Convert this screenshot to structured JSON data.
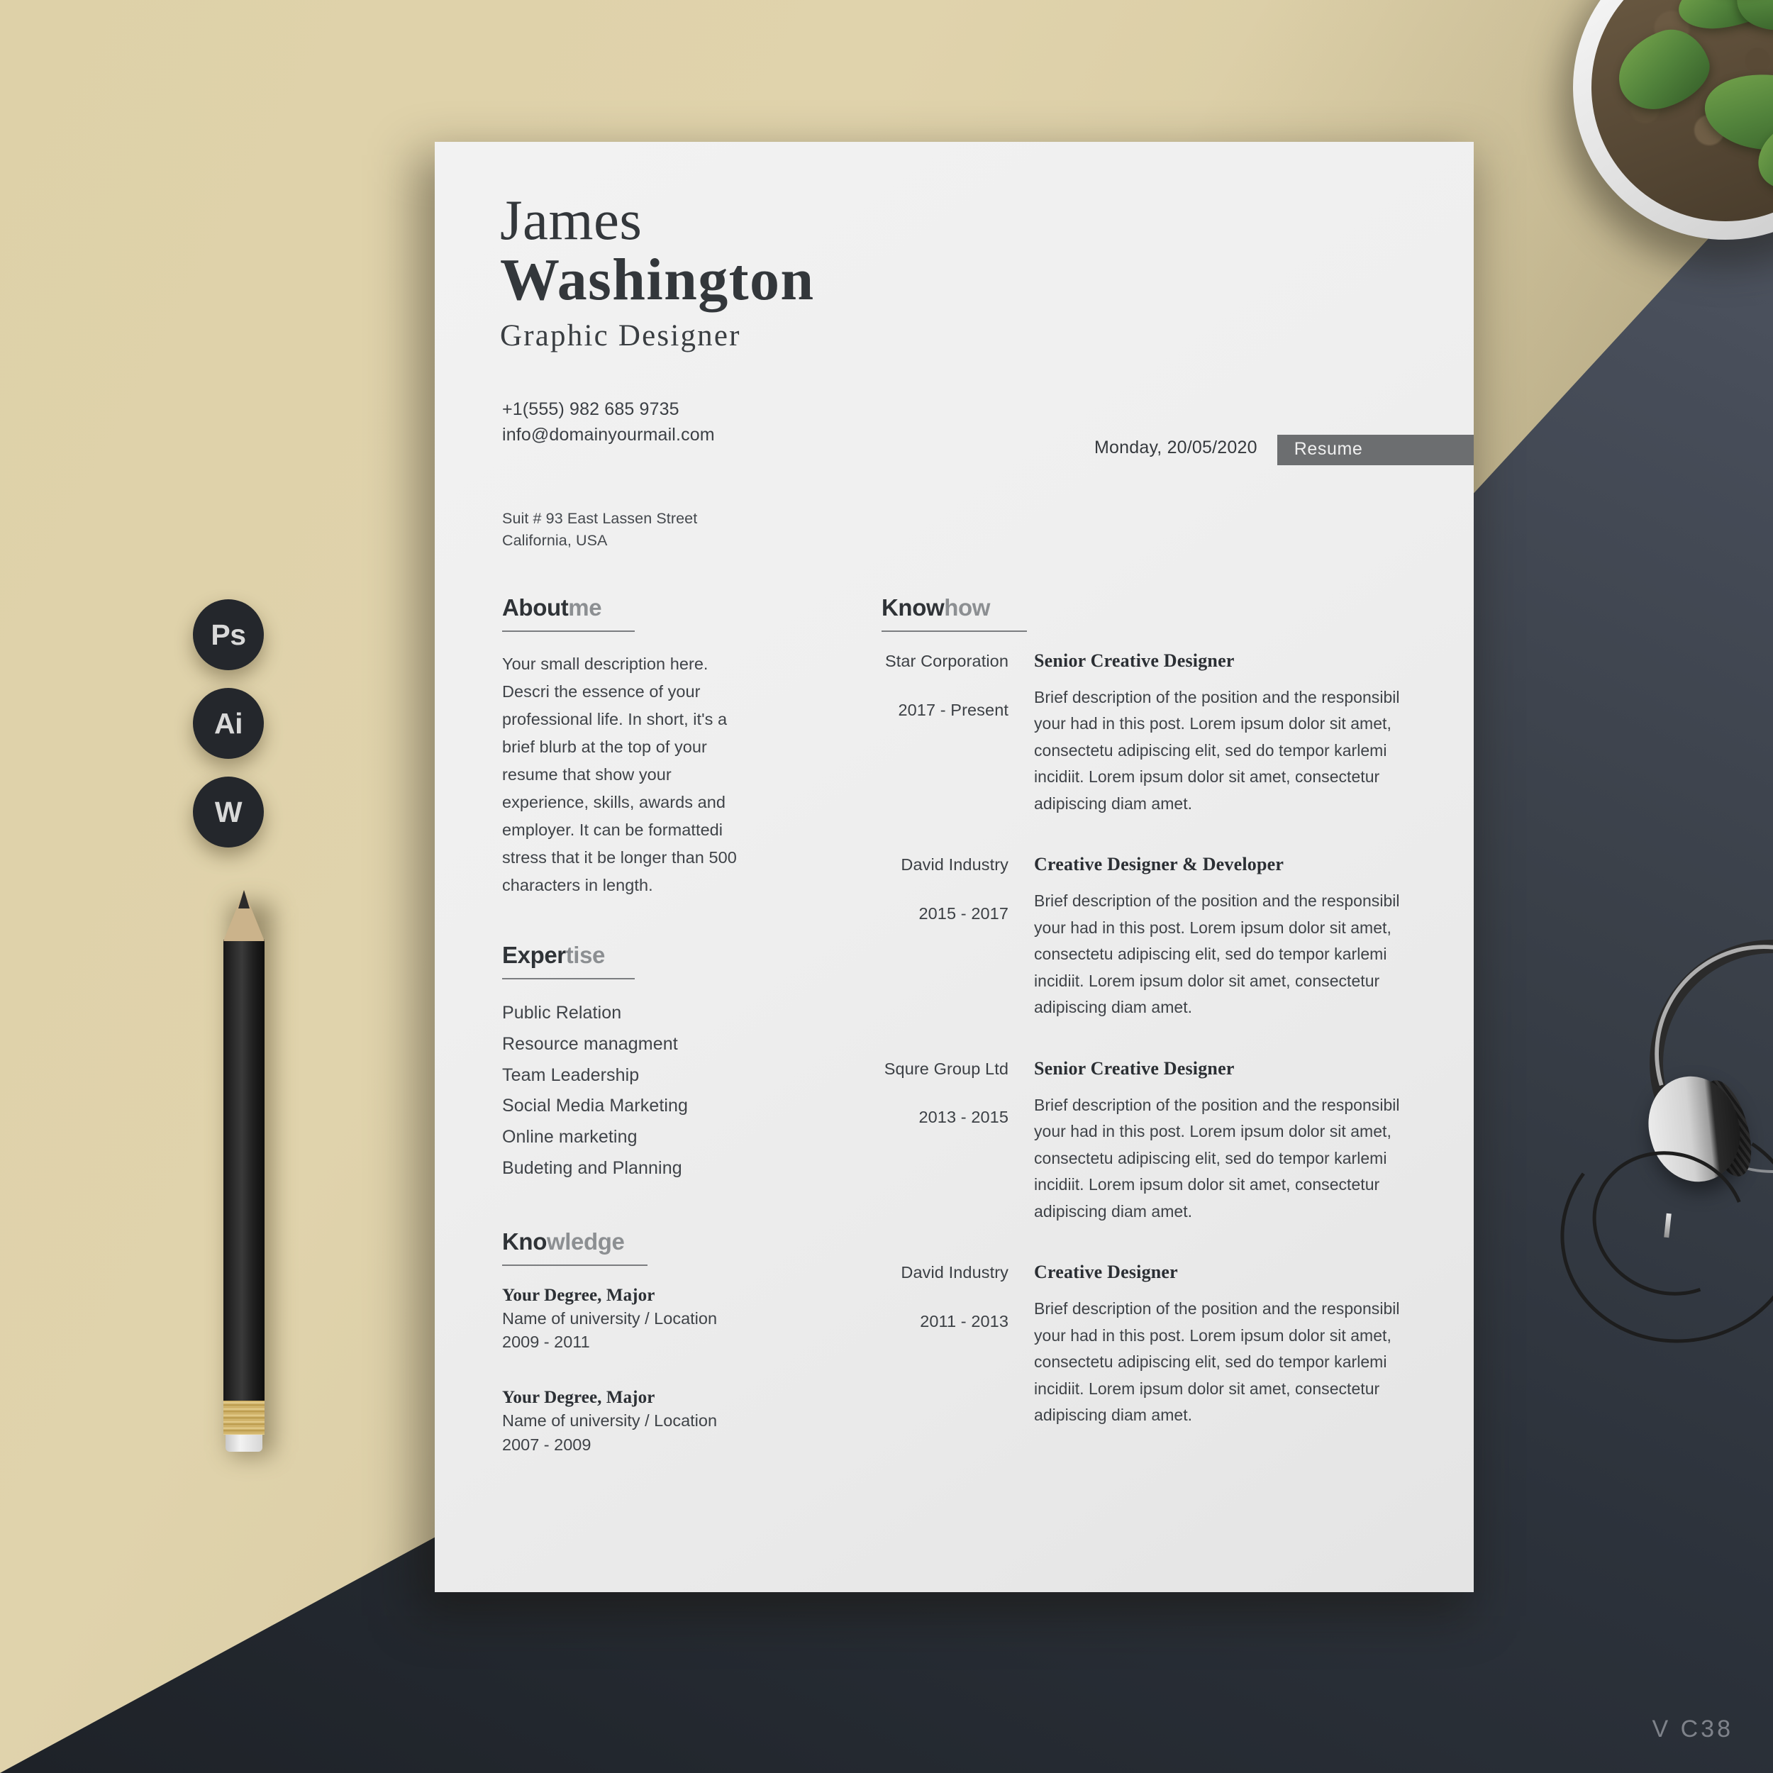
{
  "scene": {
    "background": {
      "beige_color": "#ded1a8",
      "slate_color": "#2c323b"
    },
    "watermark": "V  C38"
  },
  "badges": [
    {
      "label": "Ps",
      "name": "photoshop-badge"
    },
    {
      "label": "Ai",
      "name": "illustrator-badge"
    },
    {
      "label": "W",
      "name": "word-badge"
    }
  ],
  "resume": {
    "header": {
      "first_name": "James",
      "last_name": "Washington",
      "job_title": "Graphic Designer"
    },
    "contact": {
      "phone": "+1(555) 982 685 9735",
      "email": "info@domainyourmail.com",
      "address_line1": "Suit # 93 East Lassen Street",
      "address_line2": "California, USA"
    },
    "meta": {
      "date": "Monday, 20/05/2020",
      "tab_label": "Resume"
    },
    "about": {
      "heading_strong": "About",
      "heading_soft": "me",
      "body": "Your small description here. Descri the essence of your professional life. In short, it's a brief blurb at the top of your resume that show your experience, skills, awards and employer. It can be formattedi stress that it be longer than 500 characters in length."
    },
    "expertise": {
      "heading_strong": "Exper",
      "heading_soft": "tise",
      "items": [
        "Public Relation",
        "Resource managment",
        "Team Leadership",
        "Social Media Marketing",
        "Online marketing",
        "Budeting and Planning"
      ]
    },
    "knowledge": {
      "heading_strong": "Kno",
      "heading_soft": "wledge",
      "items": [
        {
          "degree": "Your Degree, Major",
          "university": "Name of university / Location",
          "years": "2009 - 2011"
        },
        {
          "degree": "Your Degree, Major",
          "university": "Name of university / Location",
          "years": "2007 - 2009"
        }
      ]
    },
    "knowhow": {
      "heading_strong": "Know",
      "heading_soft": "how",
      "jobs": [
        {
          "company": "Star Corporation",
          "years": "2017 - Present",
          "role": "Senior Creative Designer",
          "description": "Brief description of the position and the responsibil your had in this post. Lorem ipsum dolor sit amet, consectetu adipiscing elit, sed do tempor karlemi incidiit. Lorem ipsum dolor sit amet, consectetur adipiscing diam amet."
        },
        {
          "company": "David Industry",
          "years": "2015 - 2017",
          "role": "Creative Designer & Developer",
          "description": "Brief description of the position and the responsibil your had in this post. Lorem ipsum dolor sit amet, consectetu adipiscing elit, sed do tempor karlemi incidiit. Lorem ipsum dolor sit amet, consectetur adipiscing diam amet."
        },
        {
          "company": "Squre Group Ltd",
          "years": "2013 - 2015",
          "role": "Senior Creative Designer",
          "description": "Brief description of the position and the responsibil your had in this post. Lorem ipsum dolor sit amet, consectetu adipiscing elit, sed do tempor karlemi incidiit. Lorem ipsum dolor sit amet, consectetur adipiscing diam amet."
        },
        {
          "company": "David Industry",
          "years": "2011 - 2013",
          "role": "Creative Designer",
          "description": "Brief description of the position and the responsibil your had in this post. Lorem ipsum dolor sit amet, consectetu adipiscing elit, sed do tempor karlemi incidiit. Lorem ipsum dolor sit amet, consectetur adipiscing diam amet."
        }
      ]
    }
  }
}
